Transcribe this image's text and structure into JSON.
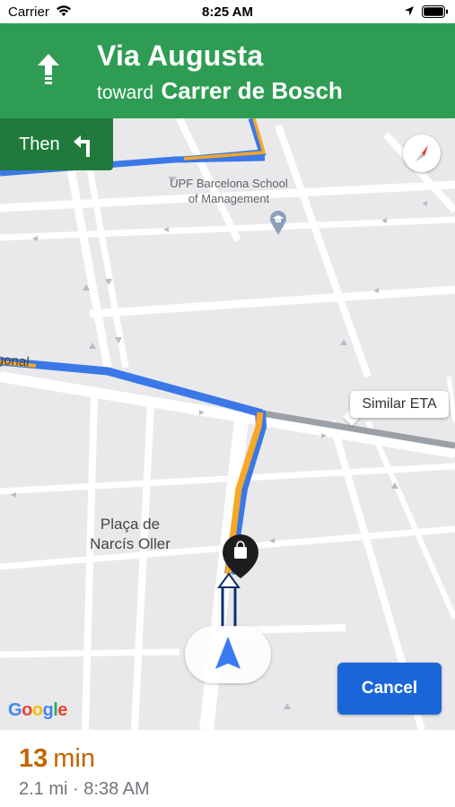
{
  "status_bar": {
    "carrier": "Carrier",
    "time": "8:25 AM"
  },
  "banner": {
    "street": "Via Augusta",
    "toward_word": "toward",
    "toward_street": "Carrer de Bosch",
    "maneuver_icon": "straight-arrow-icon",
    "background_color": "#2e9d53"
  },
  "then": {
    "label": "Then",
    "icon": "turn-left-icon"
  },
  "map": {
    "poi_name_line1": "UPF Barcelona School",
    "poi_name_line2": "of Management",
    "place_name_line1": "Plaça de",
    "place_name_line2": "Narcís Oller",
    "street_label": "gonal",
    "route_color": "#f7a827",
    "alt_route_color": "#4a84e6",
    "similar_eta_label": "Similar ETA"
  },
  "cancel_label": "Cancel",
  "attribution": {
    "letters": [
      "G",
      "o",
      "o",
      "g",
      "l",
      "e"
    ],
    "colors": [
      "#4285f4",
      "#ea4335",
      "#fbbc05",
      "#4285f4",
      "#34a853",
      "#ea4335"
    ]
  },
  "trip": {
    "duration_value": "13",
    "duration_unit": "min",
    "distance": "2.1 mi",
    "separator": "·",
    "arrival_time": "8:38 AM"
  }
}
